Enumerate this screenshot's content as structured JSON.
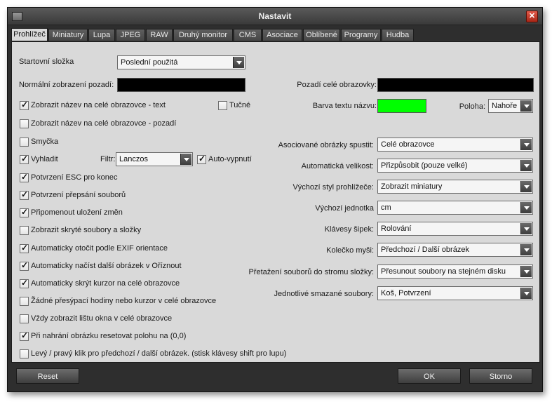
{
  "window": {
    "title": "Nastavit",
    "close_symbol": "✕"
  },
  "tabs": [
    "Prohlížeč",
    "Miniatury",
    "Lupa",
    "JPEG",
    "RAW",
    "Druhý monitor",
    "CMS",
    "Asociace",
    "Oblíbené",
    "Programy",
    "Hudba"
  ],
  "active_tab": "Prohlížeč",
  "start_folder": {
    "label": "Startovní složka",
    "value": "Poslední použitá"
  },
  "normal_bg": {
    "label": "Normální zobrazení pozadí:",
    "color": "#000000"
  },
  "fullscreen_bg": {
    "label": "Pozadí celé obrazovky:",
    "color": "#000000"
  },
  "title_text_color": {
    "label": "Barva textu názvu:",
    "color": "#00ff00"
  },
  "position": {
    "label": "Poloha:",
    "value": "Nahoře"
  },
  "filter": {
    "label": "Filtr:",
    "value": "Lanczos"
  },
  "checks": {
    "show_name_text": {
      "label": "Zobrazit název na celé obrazovce - text",
      "checked": true
    },
    "bold": {
      "label": "Tučné",
      "checked": false
    },
    "show_name_bg": {
      "label": "Zobrazit název na celé obrazovce - pozadí",
      "checked": false
    },
    "loop": {
      "label": "Smyčka",
      "checked": false
    },
    "smooth": {
      "label": "Vyhladit",
      "checked": true
    },
    "auto_off": {
      "label": "Auto-vypnutí",
      "checked": true
    },
    "esc_confirm": {
      "label": "Potvrzení ESC pro konec",
      "checked": true
    },
    "overwrite_confirm": {
      "label": "Potvrzení přepsání souborů",
      "checked": true
    },
    "remind_save": {
      "label": "Připomenout uložení změn",
      "checked": true
    },
    "show_hidden": {
      "label": "Zobrazit skryté soubory a složky",
      "checked": false
    },
    "exif_rotate": {
      "label": "Automaticky otočit podle EXIF orientace",
      "checked": true
    },
    "load_next": {
      "label": "Automaticky načíst další obrázek v Oříznout",
      "checked": true
    },
    "hide_cursor": {
      "label": "Automaticky skrýt kurzor na celé obrazovce",
      "checked": true
    },
    "no_hourglass": {
      "label": "Žádné přesýpací hodiny nebo kurzor v celé obrazovce",
      "checked": false
    },
    "always_taskbar": {
      "label": "Vždy zobrazit lištu okna v celé obrazovce",
      "checked": false
    },
    "reset_position": {
      "label": "Při nahrání obrázku resetovat polohu na (0,0)",
      "checked": true
    },
    "click_nav": {
      "label": "Levý / pravý klik pro předchozí / další obrázek. (stisk klávesy shift pro lupu)",
      "checked": false
    }
  },
  "right_settings": [
    {
      "label": "Asociované obrázky spustit:",
      "value": "Celé obrazovce"
    },
    {
      "label": "Automatická velikost:",
      "value": "Přizpůsobit (pouze velké)"
    },
    {
      "label": "Výchozí styl prohlížeče:",
      "value": "Zobrazit miniatury"
    },
    {
      "label": "Výchozí jednotka",
      "value": "cm"
    },
    {
      "label": "Klávesy šipek:",
      "value": "Rolování"
    },
    {
      "label": "Kolečko myši:",
      "value": "Předchozí / Další obrázek"
    },
    {
      "label": "Přetažení souborů do stromu složky:",
      "value": "Přesunout soubory na stejném disku"
    },
    {
      "label": "Jednotlivé smazané soubory:",
      "value": "Koš, Potvrzení"
    }
  ],
  "buttons": {
    "reset": "Reset",
    "ok": "OK",
    "cancel": "Storno"
  }
}
